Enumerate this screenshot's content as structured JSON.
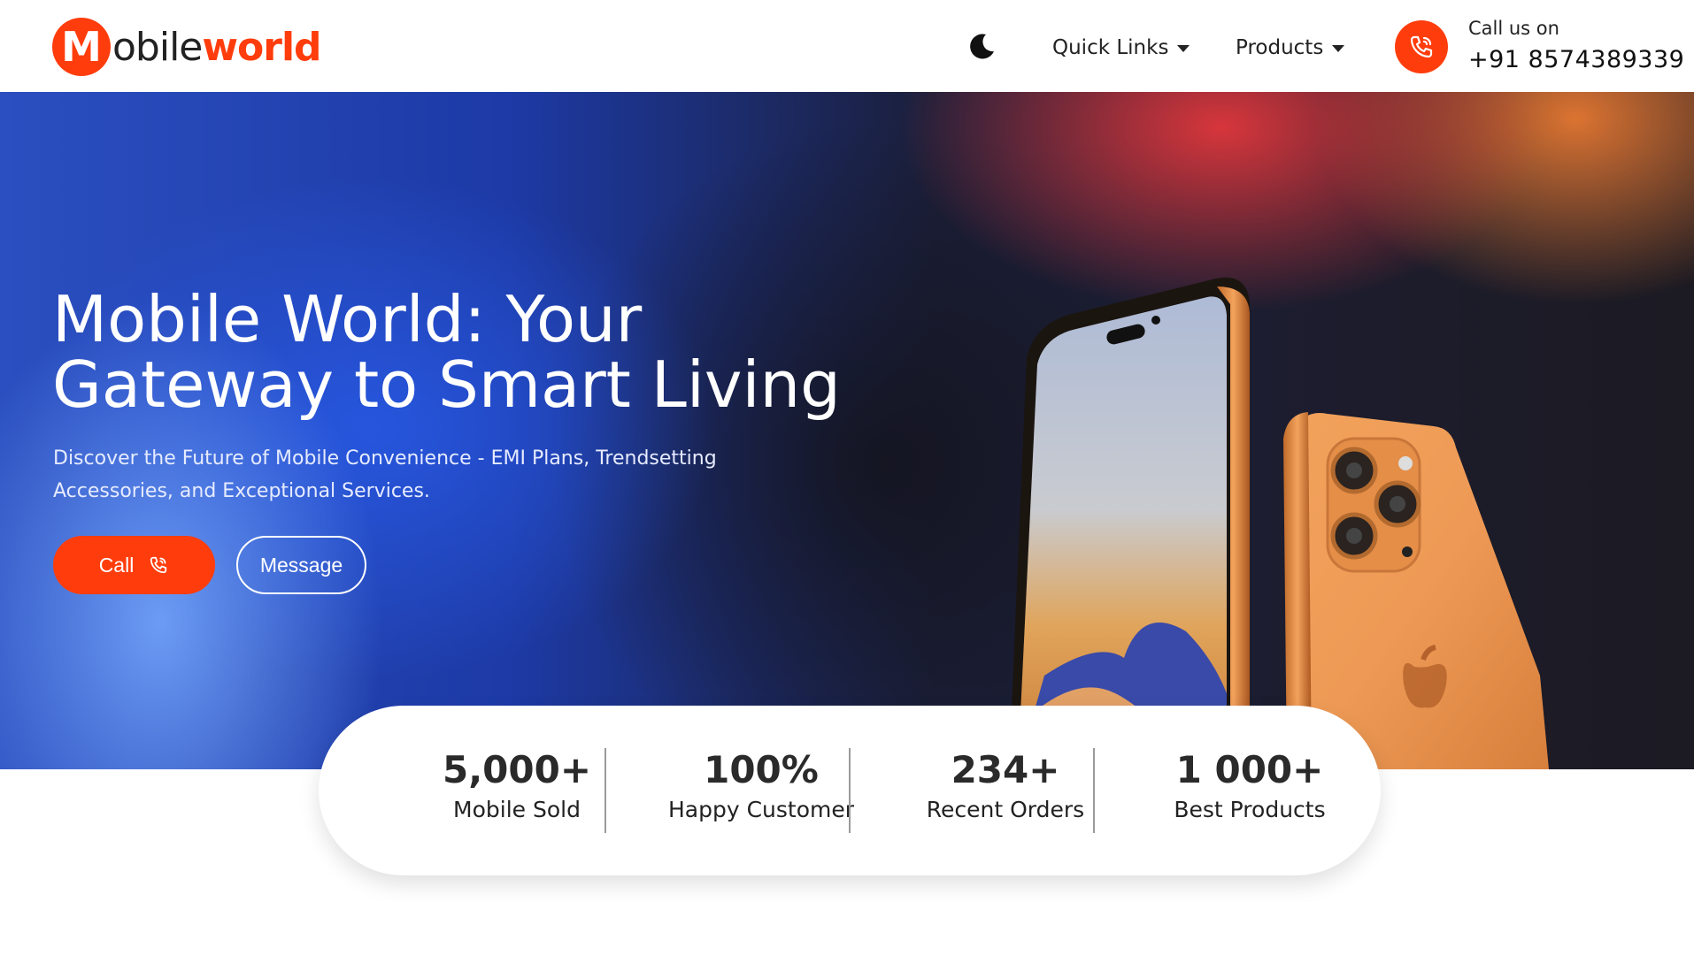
{
  "brand": {
    "badge_letter": "M",
    "name_part1": "obile",
    "name_part2": "world",
    "accent_color": "#ff3d0c"
  },
  "nav": {
    "theme_toggle_icon": "moon-icon",
    "items": [
      {
        "label": "Quick Links",
        "icon": "caret-down-icon"
      },
      {
        "label": "Products",
        "icon": "caret-down-icon"
      }
    ]
  },
  "contact": {
    "icon": "phone-icon",
    "label": "Call us on",
    "number": "+91 8574389339"
  },
  "hero": {
    "title_line1": "Mobile World: Your",
    "title_line2": "Gateway to Smart Living",
    "subtitle": "Discover the Future of Mobile Convenience - EMI Plans, Trendsetting Accessories, and Exceptional Services.",
    "call_label": "Call",
    "call_icon": "phone-icon",
    "message_label": "Message"
  },
  "stats": [
    {
      "value": "5,000+",
      "label": "Mobile Sold"
    },
    {
      "value": "100%",
      "label": "Happy Customer"
    },
    {
      "value": "234+",
      "label": "Recent Orders"
    },
    {
      "value": "1 000+",
      "label": "Best Products"
    }
  ]
}
